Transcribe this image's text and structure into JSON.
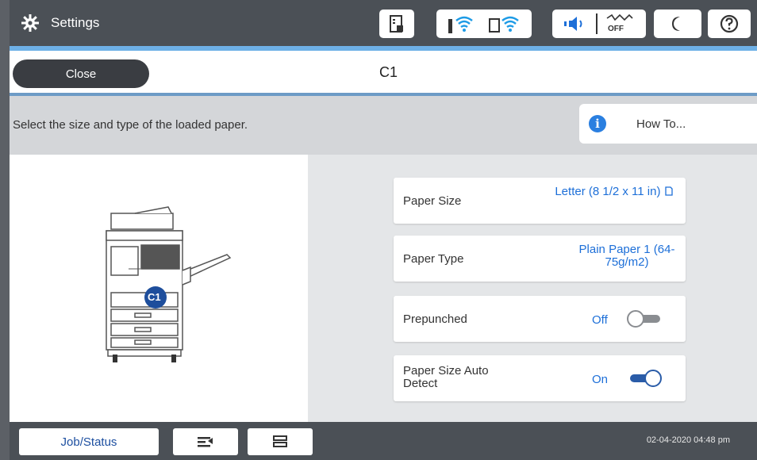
{
  "header": {
    "title": "Settings",
    "icons": [
      "gear-icon",
      "printer-status-icon",
      "wifi-icon",
      "wifi-direct-icon",
      "sound-icon",
      "power-saving-off-icon",
      "sleep-moon-icon",
      "help-icon"
    ],
    "power_saving_label": "OFF"
  },
  "titlebar": {
    "close_label": "Close",
    "screen_title": "C1"
  },
  "instruction": {
    "text": "Select the size and type of the loaded paper.",
    "howto_label": "How To...",
    "info_glyph": "i"
  },
  "printer_illustration": {
    "badge": "C1"
  },
  "settings": [
    {
      "label": "Paper Size",
      "value": "Letter (8 1/2 x 11 in)"
    },
    {
      "label": "Paper Type",
      "value": "Plain Paper 1 (64-75g/m2)"
    },
    {
      "label": "Prepunched",
      "value": "Off",
      "state": false
    },
    {
      "label": "Paper Size Auto Detect",
      "value": "On",
      "state": true
    }
  ],
  "footer": {
    "job_status_label": "Job/Status",
    "datetime": "02-04-2020 04:48 pm"
  },
  "colors": {
    "accent": "#1d6fd8",
    "topbar": "#4b5056",
    "toggle_on": "#2a5ca8"
  }
}
